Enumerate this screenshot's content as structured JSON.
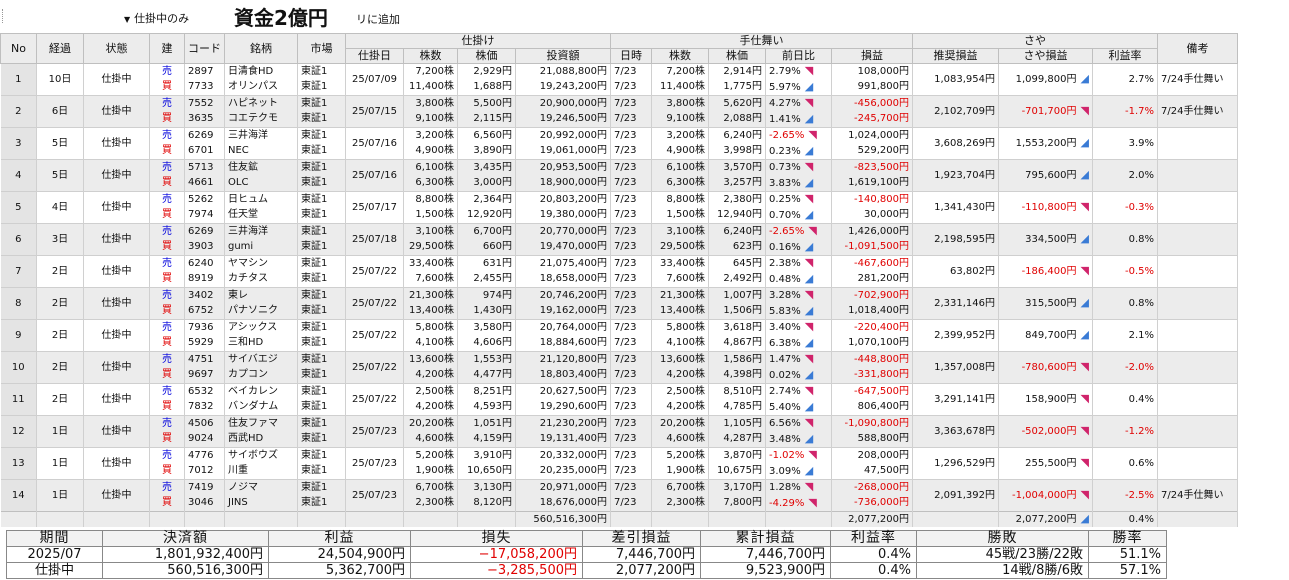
{
  "toolbar": {
    "filter_label": "仕掛中のみ",
    "capital_overlay": "資金2億円",
    "add_label": "リに追加"
  },
  "headers": {
    "no": "No",
    "elapsed": "経過",
    "status": "状態",
    "side": "建",
    "code": "コード",
    "name": "銘柄",
    "market": "市場",
    "open_group": "仕掛け",
    "close_group": "手仕舞い",
    "spread_group": "さや",
    "note": "備考",
    "open_date": "仕掛日",
    "shares": "株数",
    "price": "株価",
    "amount": "投資額",
    "close_date": "日時",
    "close_shares": "株数",
    "close_price": "株価",
    "day_change": "前日比",
    "pnl": "損益",
    "rec_pnl": "推奨損益",
    "spread_pnl": "さや損益",
    "profit_rate": "利益率"
  },
  "rows": [
    {
      "no": "1",
      "elapsed": "10日",
      "status": "仕掛中",
      "date": "25/07/09",
      "rec": "1,083,954円",
      "spread": "1,099,800円",
      "spread_neg": false,
      "trend": "up",
      "rate": "2.7%",
      "rate_neg": false,
      "note": "7/24手仕舞い",
      "legs": [
        {
          "side": "売",
          "code": "2897",
          "name": "日清食HD",
          "market": "東証1",
          "shares": "7,200株",
          "price": "2,929円",
          "amount": "21,088,800円",
          "cdate": "7/23",
          "cshares": "7,200株",
          "cprice": "2,914円",
          "chg": "2.79%",
          "chg_neg": false,
          "chg_dir": "dn",
          "pnl": "108,000円",
          "pnl_neg": false
        },
        {
          "side": "買",
          "code": "7733",
          "name": "オリンパス",
          "market": "東証1",
          "shares": "11,400株",
          "price": "1,688円",
          "amount": "19,243,200円",
          "cdate": "7/23",
          "cshares": "11,400株",
          "cprice": "1,775円",
          "chg": "5.97%",
          "chg_neg": false,
          "chg_dir": "up",
          "pnl": "991,800円",
          "pnl_neg": false
        }
      ]
    },
    {
      "no": "2",
      "elapsed": "6日",
      "status": "仕掛中",
      "date": "25/07/15",
      "rec": "2,102,709円",
      "spread": "-701,700円",
      "spread_neg": true,
      "trend": "dn",
      "rate": "-1.7%",
      "rate_neg": true,
      "note": "7/24手仕舞い",
      "legs": [
        {
          "side": "売",
          "code": "7552",
          "name": "ハピネット",
          "market": "東証1",
          "shares": "3,800株",
          "price": "5,500円",
          "amount": "20,900,000円",
          "cdate": "7/23",
          "cshares": "3,800株",
          "cprice": "5,620円",
          "chg": "4.27%",
          "chg_neg": false,
          "chg_dir": "dn",
          "pnl": "-456,000円",
          "pnl_neg": true
        },
        {
          "side": "買",
          "code": "3635",
          "name": "コエテクモ",
          "market": "東証1",
          "shares": "9,100株",
          "price": "2,115円",
          "amount": "19,246,500円",
          "cdate": "7/23",
          "cshares": "9,100株",
          "cprice": "2,088円",
          "chg": "1.41%",
          "chg_neg": false,
          "chg_dir": "up",
          "pnl": "-245,700円",
          "pnl_neg": true
        }
      ]
    },
    {
      "no": "3",
      "elapsed": "5日",
      "status": "仕掛中",
      "date": "25/07/16",
      "rec": "3,608,269円",
      "spread": "1,553,200円",
      "spread_neg": false,
      "trend": "up",
      "rate": "3.9%",
      "rate_neg": false,
      "note": "",
      "legs": [
        {
          "side": "売",
          "code": "6269",
          "name": "三井海洋",
          "market": "東証1",
          "shares": "3,200株",
          "price": "6,560円",
          "amount": "20,992,000円",
          "cdate": "7/23",
          "cshares": "3,200株",
          "cprice": "6,240円",
          "chg": "-2.65%",
          "chg_neg": true,
          "chg_dir": "dn",
          "pnl": "1,024,000円",
          "pnl_neg": false
        },
        {
          "side": "買",
          "code": "6701",
          "name": "NEC",
          "market": "東証1",
          "shares": "4,900株",
          "price": "3,890円",
          "amount": "19,061,000円",
          "cdate": "7/23",
          "cshares": "4,900株",
          "cprice": "3,998円",
          "chg": "0.23%",
          "chg_neg": false,
          "chg_dir": "up",
          "pnl": "529,200円",
          "pnl_neg": false
        }
      ]
    },
    {
      "no": "4",
      "elapsed": "5日",
      "status": "仕掛中",
      "date": "25/07/16",
      "rec": "1,923,704円",
      "spread": "795,600円",
      "spread_neg": false,
      "trend": "up",
      "rate": "2.0%",
      "rate_neg": false,
      "note": "",
      "legs": [
        {
          "side": "売",
          "code": "5713",
          "name": "住友鉱",
          "market": "東証1",
          "shares": "6,100株",
          "price": "3,435円",
          "amount": "20,953,500円",
          "cdate": "7/23",
          "cshares": "6,100株",
          "cprice": "3,570円",
          "chg": "0.73%",
          "chg_neg": false,
          "chg_dir": "dn",
          "pnl": "-823,500円",
          "pnl_neg": true
        },
        {
          "side": "買",
          "code": "4661",
          "name": "OLC",
          "market": "東証1",
          "shares": "6,300株",
          "price": "3,000円",
          "amount": "18,900,000円",
          "cdate": "7/23",
          "cshares": "6,300株",
          "cprice": "3,257円",
          "chg": "3.83%",
          "chg_neg": false,
          "chg_dir": "up",
          "pnl": "1,619,100円",
          "pnl_neg": false
        }
      ]
    },
    {
      "no": "5",
      "elapsed": "4日",
      "status": "仕掛中",
      "date": "25/07/17",
      "rec": "1,341,430円",
      "spread": "-110,800円",
      "spread_neg": true,
      "trend": "dn",
      "rate": "-0.3%",
      "rate_neg": true,
      "note": "",
      "legs": [
        {
          "side": "売",
          "code": "5262",
          "name": "日ヒュム",
          "market": "東証1",
          "shares": "8,800株",
          "price": "2,364円",
          "amount": "20,803,200円",
          "cdate": "7/23",
          "cshares": "8,800株",
          "cprice": "2,380円",
          "chg": "0.25%",
          "chg_neg": false,
          "chg_dir": "dn",
          "pnl": "-140,800円",
          "pnl_neg": true
        },
        {
          "side": "買",
          "code": "7974",
          "name": "任天堂",
          "market": "東証1",
          "shares": "1,500株",
          "price": "12,920円",
          "amount": "19,380,000円",
          "cdate": "7/23",
          "cshares": "1,500株",
          "cprice": "12,940円",
          "chg": "0.70%",
          "chg_neg": false,
          "chg_dir": "up",
          "pnl": "30,000円",
          "pnl_neg": false
        }
      ]
    },
    {
      "no": "6",
      "elapsed": "3日",
      "status": "仕掛中",
      "date": "25/07/18",
      "rec": "2,198,595円",
      "spread": "334,500円",
      "spread_neg": false,
      "trend": "up",
      "rate": "0.8%",
      "rate_neg": false,
      "note": "",
      "legs": [
        {
          "side": "売",
          "code": "6269",
          "name": "三井海洋",
          "market": "東証1",
          "shares": "3,100株",
          "price": "6,700円",
          "amount": "20,770,000円",
          "cdate": "7/23",
          "cshares": "3,100株",
          "cprice": "6,240円",
          "chg": "-2.65%",
          "chg_neg": true,
          "chg_dir": "dn",
          "pnl": "1,426,000円",
          "pnl_neg": false
        },
        {
          "side": "買",
          "code": "3903",
          "name": "gumi",
          "market": "東証1",
          "shares": "29,500株",
          "price": "660円",
          "amount": "19,470,000円",
          "cdate": "7/23",
          "cshares": "29,500株",
          "cprice": "623円",
          "chg": "0.16%",
          "chg_neg": false,
          "chg_dir": "up",
          "pnl": "-1,091,500円",
          "pnl_neg": true
        }
      ]
    },
    {
      "no": "7",
      "elapsed": "2日",
      "status": "仕掛中",
      "date": "25/07/22",
      "rec": "63,802円",
      "spread": "-186,400円",
      "spread_neg": true,
      "trend": "dn",
      "rate": "-0.5%",
      "rate_neg": true,
      "note": "",
      "legs": [
        {
          "side": "売",
          "code": "6240",
          "name": "ヤマシン",
          "market": "東証1",
          "shares": "33,400株",
          "price": "631円",
          "amount": "21,075,400円",
          "cdate": "7/23",
          "cshares": "33,400株",
          "cprice": "645円",
          "chg": "2.38%",
          "chg_neg": false,
          "chg_dir": "dn",
          "pnl": "-467,600円",
          "pnl_neg": true
        },
        {
          "side": "買",
          "code": "8919",
          "name": "カチタス",
          "market": "東証1",
          "shares": "7,600株",
          "price": "2,455円",
          "amount": "18,658,000円",
          "cdate": "7/23",
          "cshares": "7,600株",
          "cprice": "2,492円",
          "chg": "0.48%",
          "chg_neg": false,
          "chg_dir": "up",
          "pnl": "281,200円",
          "pnl_neg": false
        }
      ]
    },
    {
      "no": "8",
      "elapsed": "2日",
      "status": "仕掛中",
      "date": "25/07/22",
      "rec": "2,331,146円",
      "spread": "315,500円",
      "spread_neg": false,
      "trend": "up",
      "rate": "0.8%",
      "rate_neg": false,
      "note": "",
      "legs": [
        {
          "side": "売",
          "code": "3402",
          "name": "東レ",
          "market": "東証1",
          "shares": "21,300株",
          "price": "974円",
          "amount": "20,746,200円",
          "cdate": "7/23",
          "cshares": "21,300株",
          "cprice": "1,007円",
          "chg": "3.28%",
          "chg_neg": false,
          "chg_dir": "dn",
          "pnl": "-702,900円",
          "pnl_neg": true
        },
        {
          "side": "買",
          "code": "6752",
          "name": "パナソニク",
          "market": "東証1",
          "shares": "13,400株",
          "price": "1,430円",
          "amount": "19,162,000円",
          "cdate": "7/23",
          "cshares": "13,400株",
          "cprice": "1,506円",
          "chg": "5.83%",
          "chg_neg": false,
          "chg_dir": "up",
          "pnl": "1,018,400円",
          "pnl_neg": false
        }
      ]
    },
    {
      "no": "9",
      "elapsed": "2日",
      "status": "仕掛中",
      "date": "25/07/22",
      "rec": "2,399,952円",
      "spread": "849,700円",
      "spread_neg": false,
      "trend": "up",
      "rate": "2.1%",
      "rate_neg": false,
      "note": "",
      "legs": [
        {
          "side": "売",
          "code": "7936",
          "name": "アシックス",
          "market": "東証1",
          "shares": "5,800株",
          "price": "3,580円",
          "amount": "20,764,000円",
          "cdate": "7/23",
          "cshares": "5,800株",
          "cprice": "3,618円",
          "chg": "3.40%",
          "chg_neg": false,
          "chg_dir": "dn",
          "pnl": "-220,400円",
          "pnl_neg": true
        },
        {
          "side": "買",
          "code": "5929",
          "name": "三和HD",
          "market": "東証1",
          "shares": "4,100株",
          "price": "4,606円",
          "amount": "18,884,600円",
          "cdate": "7/23",
          "cshares": "4,100株",
          "cprice": "4,867円",
          "chg": "6.38%",
          "chg_neg": false,
          "chg_dir": "up",
          "pnl": "1,070,100円",
          "pnl_neg": false
        }
      ]
    },
    {
      "no": "10",
      "elapsed": "2日",
      "status": "仕掛中",
      "date": "25/07/22",
      "rec": "1,357,008円",
      "spread": "-780,600円",
      "spread_neg": true,
      "trend": "dn",
      "rate": "-2.0%",
      "rate_neg": true,
      "note": "",
      "legs": [
        {
          "side": "売",
          "code": "4751",
          "name": "サイバエジ",
          "market": "東証1",
          "shares": "13,600株",
          "price": "1,553円",
          "amount": "21,120,800円",
          "cdate": "7/23",
          "cshares": "13,600株",
          "cprice": "1,586円",
          "chg": "1.47%",
          "chg_neg": false,
          "chg_dir": "dn",
          "pnl": "-448,800円",
          "pnl_neg": true
        },
        {
          "side": "買",
          "code": "9697",
          "name": "カプコン",
          "market": "東証1",
          "shares": "4,200株",
          "price": "4,477円",
          "amount": "18,803,400円",
          "cdate": "7/23",
          "cshares": "4,200株",
          "cprice": "4,398円",
          "chg": "0.02%",
          "chg_neg": false,
          "chg_dir": "up",
          "pnl": "-331,800円",
          "pnl_neg": true
        }
      ]
    },
    {
      "no": "11",
      "elapsed": "2日",
      "status": "仕掛中",
      "date": "25/07/22",
      "rec": "3,291,141円",
      "spread": "158,900円",
      "spread_neg": false,
      "trend": "dn",
      "rate": "0.4%",
      "rate_neg": false,
      "note": "",
      "legs": [
        {
          "side": "売",
          "code": "6532",
          "name": "ベイカレン",
          "market": "東証1",
          "shares": "2,500株",
          "price": "8,251円",
          "amount": "20,627,500円",
          "cdate": "7/23",
          "cshares": "2,500株",
          "cprice": "8,510円",
          "chg": "2.74%",
          "chg_neg": false,
          "chg_dir": "dn",
          "pnl": "-647,500円",
          "pnl_neg": true
        },
        {
          "side": "買",
          "code": "7832",
          "name": "バンダナム",
          "market": "東証1",
          "shares": "4,200株",
          "price": "4,593円",
          "amount": "19,290,600円",
          "cdate": "7/23",
          "cshares": "4,200株",
          "cprice": "4,785円",
          "chg": "5.40%",
          "chg_neg": false,
          "chg_dir": "up",
          "pnl": "806,400円",
          "pnl_neg": false
        }
      ]
    },
    {
      "no": "12",
      "elapsed": "1日",
      "status": "仕掛中",
      "date": "25/07/23",
      "rec": "3,363,678円",
      "spread": "-502,000円",
      "spread_neg": true,
      "trend": "dn",
      "rate": "-1.2%",
      "rate_neg": true,
      "note": "",
      "legs": [
        {
          "side": "売",
          "code": "4506",
          "name": "住友ファマ",
          "market": "東証1",
          "shares": "20,200株",
          "price": "1,051円",
          "amount": "21,230,200円",
          "cdate": "7/23",
          "cshares": "20,200株",
          "cprice": "1,105円",
          "chg": "6.56%",
          "chg_neg": false,
          "chg_dir": "dn",
          "pnl": "-1,090,800円",
          "pnl_neg": true
        },
        {
          "side": "買",
          "code": "9024",
          "name": "西武HD",
          "market": "東証1",
          "shares": "4,600株",
          "price": "4,159円",
          "amount": "19,131,400円",
          "cdate": "7/23",
          "cshares": "4,600株",
          "cprice": "4,287円",
          "chg": "3.48%",
          "chg_neg": false,
          "chg_dir": "up",
          "pnl": "588,800円",
          "pnl_neg": false
        }
      ]
    },
    {
      "no": "13",
      "elapsed": "1日",
      "status": "仕掛中",
      "date": "25/07/23",
      "rec": "1,296,529円",
      "spread": "255,500円",
      "spread_neg": false,
      "trend": "dn",
      "rate": "0.6%",
      "rate_neg": false,
      "note": "",
      "legs": [
        {
          "side": "売",
          "code": "4776",
          "name": "サイボウズ",
          "market": "東証1",
          "shares": "5,200株",
          "price": "3,910円",
          "amount": "20,332,000円",
          "cdate": "7/23",
          "cshares": "5,200株",
          "cprice": "3,870円",
          "chg": "-1.02%",
          "chg_neg": true,
          "chg_dir": "dn",
          "pnl": "208,000円",
          "pnl_neg": false
        },
        {
          "side": "買",
          "code": "7012",
          "name": "川重",
          "market": "東証1",
          "shares": "1,900株",
          "price": "10,650円",
          "amount": "20,235,000円",
          "cdate": "7/23",
          "cshares": "1,900株",
          "cprice": "10,675円",
          "chg": "3.09%",
          "chg_neg": false,
          "chg_dir": "up",
          "pnl": "47,500円",
          "pnl_neg": false
        }
      ]
    },
    {
      "no": "14",
      "elapsed": "1日",
      "status": "仕掛中",
      "date": "25/07/23",
      "rec": "2,091,392円",
      "spread": "-1,004,000円",
      "spread_neg": true,
      "trend": "dn",
      "rate": "-2.5%",
      "rate_neg": true,
      "note": "7/24手仕舞い",
      "legs": [
        {
          "side": "売",
          "code": "7419",
          "name": "ノジマ",
          "market": "東証1",
          "shares": "6,700株",
          "price": "3,130円",
          "amount": "20,971,000円",
          "cdate": "7/23",
          "cshares": "6,700株",
          "cprice": "3,170円",
          "chg": "1.28%",
          "chg_neg": false,
          "chg_dir": "dn",
          "pnl": "-268,000円",
          "pnl_neg": true
        },
        {
          "side": "買",
          "code": "3046",
          "name": "JINS",
          "market": "東証1",
          "shares": "2,300株",
          "price": "8,120円",
          "amount": "18,676,000円",
          "cdate": "7/23",
          "cshares": "2,300株",
          "cprice": "7,800円",
          "chg": "-4.29%",
          "chg_neg": true,
          "chg_dir": "dn",
          "pnl": "-736,000円",
          "pnl_neg": true
        }
      ]
    }
  ],
  "totals": {
    "amount": "560,516,300円",
    "pnl": "2,077,200円",
    "spread": "2,077,200円",
    "rate": "0.4%"
  },
  "summary": {
    "headers": [
      "期間",
      "決済額",
      "利益",
      "損失",
      "差引損益",
      "累計損益",
      "利益率",
      "勝敗",
      "勝率"
    ],
    "rows": [
      [
        "2025/07",
        "1,801,932,400円",
        "24,504,900円",
        "−17,058,200円",
        "7,446,700円",
        "7,446,700円",
        "0.4%",
        "45戦/23勝/22敗",
        "51.1%"
      ],
      [
        "仕掛中",
        "560,516,300円",
        "5,362,700円",
        "−3,285,500円",
        "2,077,200円",
        "9,523,900円",
        "0.4%",
        "14戦/8勝/6敗",
        "57.1%"
      ]
    ]
  },
  "colors": {
    "negative": "#e00000",
    "sell": "#0000dd",
    "up_arrow": "#3a7bd5",
    "down_arrow": "#d0246b"
  }
}
